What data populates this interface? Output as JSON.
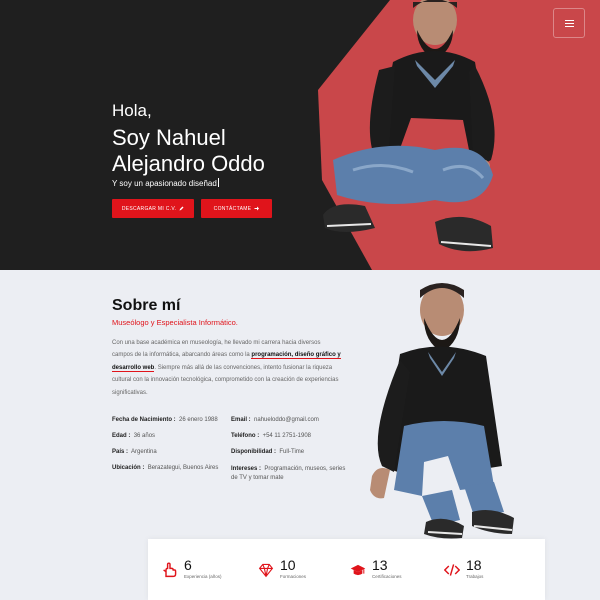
{
  "hero": {
    "greeting": "Hola,",
    "name": "Soy Nahuel Alejandro Oddo",
    "typed_text": "Y soy un apasionado diseñad",
    "cv_button": "DESCARGAR MI C.V.",
    "contact_button": "CONTÁCTAME",
    "colors": {
      "dark": "#1f1f1f",
      "accent_panel": "#c9474a",
      "button": "#e0141b"
    },
    "menu_icon": "hamburger-icon"
  },
  "about": {
    "title": "Sobre mí",
    "role": "Museólogo y Especialista Informático.",
    "text_before": "Con una base académica en museología, he llevado mi carrera hacia diversos campos de la informática, abarcando áreas como la ",
    "text_highlight": "programación, diseño gráfico y desarrollo web",
    "text_after": ". Siempre más allá de las convenciones, intento fusionar la riqueza cultural con la innovación tecnológica, comprometido con la creación de experiencias significativas.",
    "info_left": [
      {
        "label": "Fecha de Nacimiento :",
        "value": "26 enero 1988"
      },
      {
        "label": "Edad :",
        "value": "36 años"
      },
      {
        "label": "País :",
        "value": "Argentina"
      },
      {
        "label": "Ubicación :",
        "value": "Berazategui, Buenos Aires"
      }
    ],
    "info_right": [
      {
        "label": "Email :",
        "value": "nahueloddo@gmail.com"
      },
      {
        "label": "Teléfono :",
        "value": "+54 11 2751-1908"
      },
      {
        "label": "Disponibilidad :",
        "value": "Full-Time"
      },
      {
        "label": "Intereses :",
        "value": "Programación, museos, series de TV y tomar mate"
      }
    ]
  },
  "stats": [
    {
      "icon": "hand-icon",
      "number": "6",
      "label": "Experiencia (años)"
    },
    {
      "icon": "diamond-icon",
      "number": "10",
      "label": "Formaciones"
    },
    {
      "icon": "graduation-cap-icon",
      "number": "13",
      "label": "Certificaciones"
    },
    {
      "icon": "code-icon",
      "number": "18",
      "label": "Trabajos"
    }
  ]
}
